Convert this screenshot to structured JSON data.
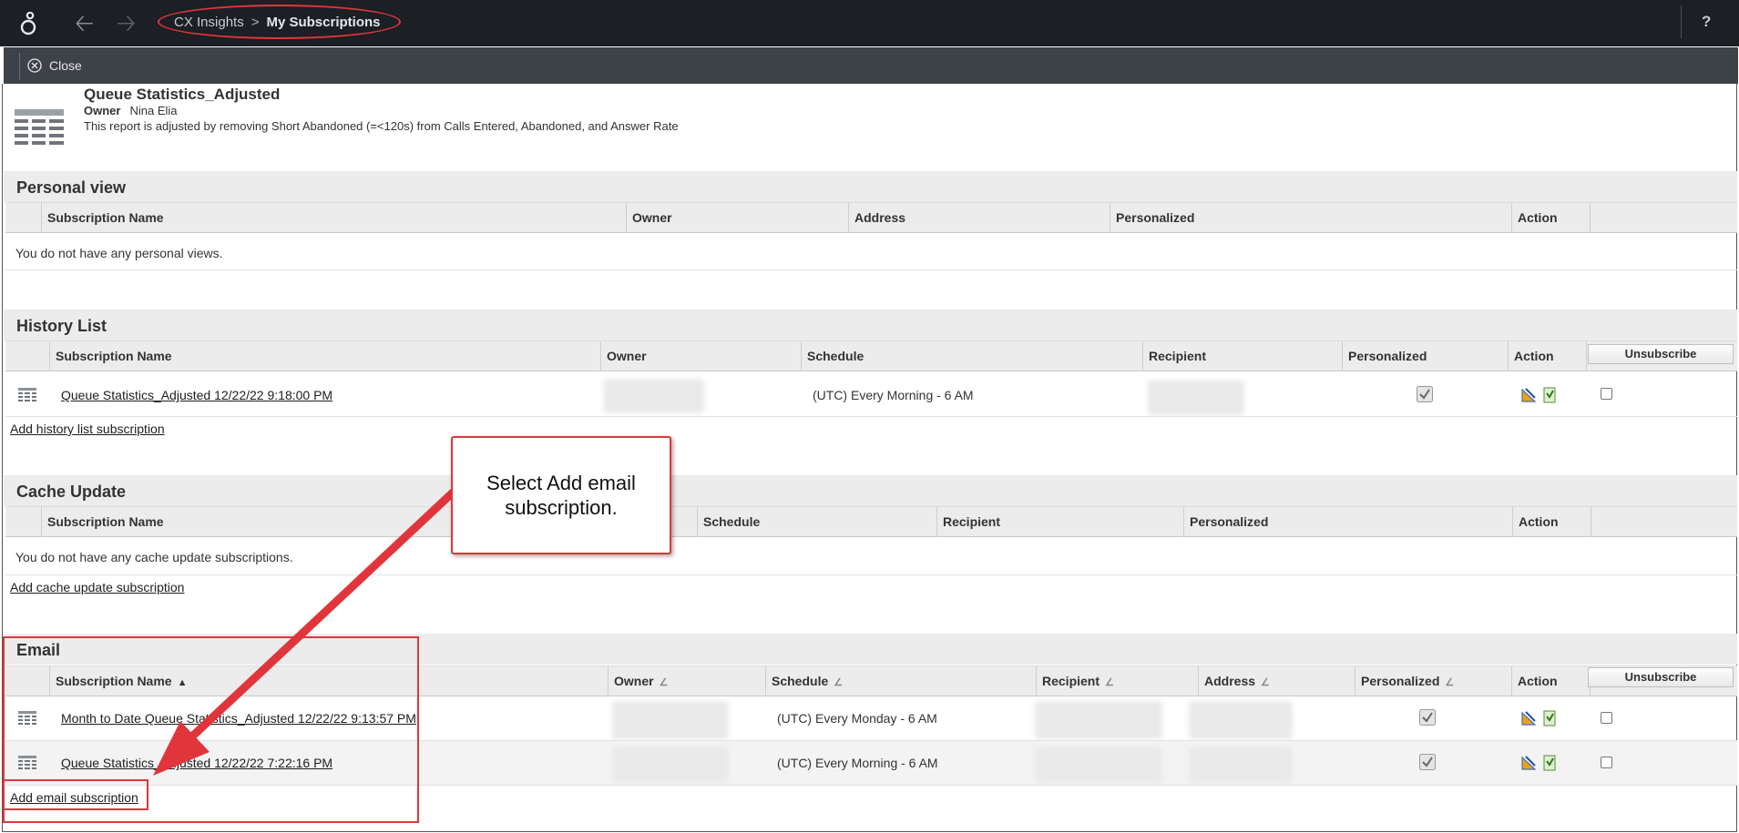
{
  "topbar": {
    "breadcrumb": [
      "CX Insights",
      "My Subscriptions"
    ],
    "help_label": "?",
    "icons": [
      "genesys-logo-icon",
      "back-arrow-icon",
      "forward-arrow-icon"
    ]
  },
  "toolbar": {
    "close_label": "Close"
  },
  "report": {
    "title": "Queue Statistics_Adjusted",
    "owner_label": "Owner",
    "owner_value": "Nina Elia",
    "description": "This report is adjusted by removing Short Abandoned (=<120s) from Calls Entered, Abandoned, and Answer Rate"
  },
  "personal_view": {
    "title": "Personal view",
    "columns": [
      "Subscription Name",
      "Owner",
      "Address",
      "Personalized",
      "Action"
    ],
    "empty_text": "You do not have any personal views."
  },
  "history_list": {
    "title": "History List",
    "columns": [
      "Subscription Name",
      "Owner",
      "Schedule",
      "Recipient",
      "Personalized",
      "Action"
    ],
    "unsubscribe_label": "Unsubscribe",
    "rows": [
      {
        "name": "Queue Statistics_Adjusted 12/22/22 9:18:00 PM",
        "schedule": "(UTC) Every Morning - 6 AM",
        "personalized": true
      }
    ],
    "add_link": "Add history list subscription"
  },
  "cache_update": {
    "title": "Cache Update",
    "columns": [
      "Subscription Name",
      "Schedule",
      "Recipient",
      "Personalized",
      "Action"
    ],
    "empty_text": "You do not have any cache update subscriptions.",
    "add_link": "Add cache update subscription"
  },
  "email": {
    "title": "Email",
    "columns": [
      "Subscription Name",
      "Owner",
      "Schedule",
      "Recipient",
      "Address",
      "Personalized",
      "Action"
    ],
    "sort_asc_symbol": "▲",
    "unsubscribe_label": "Unsubscribe",
    "rows": [
      {
        "name": "Month to Date Queue Statistics_Adjusted 12/22/22 9:13:57 PM",
        "schedule": "(UTC) Every Monday - 6 AM",
        "personalized": true
      },
      {
        "name": "Queue Statistics_Adjusted 12/22/22 7:22:16 PM",
        "schedule": "(UTC) Every Morning - 6 AM",
        "personalized": true
      }
    ],
    "add_link": "Add email subscription"
  },
  "annotation": {
    "callout_text": "Select Add email subscription.",
    "color": "#e0363b"
  },
  "colors": {
    "topbar": "#1c1f24",
    "subbar": "#3d4248",
    "section_band": "#ececec"
  }
}
